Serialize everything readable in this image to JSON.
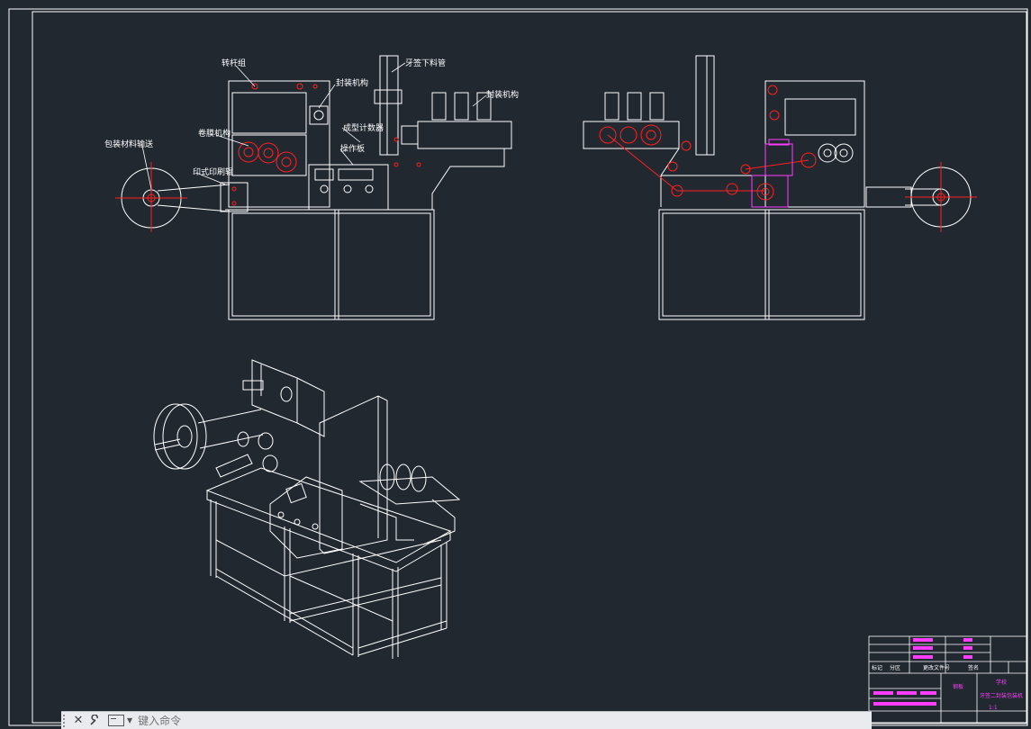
{
  "drawing": {
    "background": "#212830",
    "line_color": "#ffffff",
    "accent_red": "#ff2020",
    "accent_magenta": "#ff3cff",
    "labels_front": [
      {
        "name": "label-a",
        "text": "转杆组"
      },
      {
        "name": "label-b",
        "text": "封装机构"
      },
      {
        "name": "label-c",
        "text": "牙签下料管"
      },
      {
        "name": "label-d",
        "text": "封装机构"
      },
      {
        "name": "label-e",
        "text": "包装材料输送"
      },
      {
        "name": "label-f",
        "text": "卷膜机构"
      },
      {
        "name": "label-g",
        "text": "成型计数器"
      },
      {
        "name": "label-h",
        "text": "操作板"
      },
      {
        "name": "label-i",
        "text": "印式印刷辊"
      }
    ]
  },
  "title_block": {
    "material": "钢板",
    "school": "学校",
    "drawing_title": "牙签二封装包装机",
    "scale": "1:1",
    "h1": "标记",
    "h2": "分区",
    "h3": "更改文件号",
    "h4": "签名"
  },
  "command_bar": {
    "close_icon": "close-icon",
    "wrench_icon": "wrench-icon",
    "placeholder": "键入命令"
  }
}
